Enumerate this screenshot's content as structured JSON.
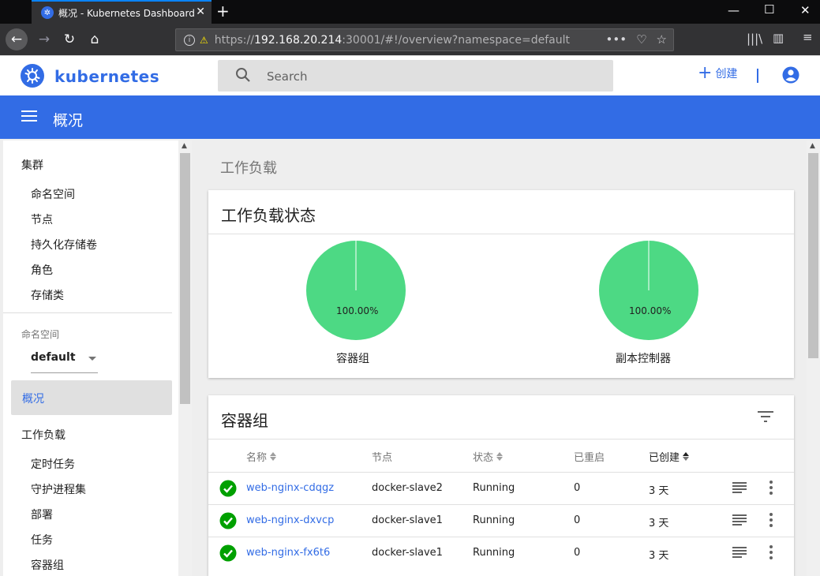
{
  "browser": {
    "tab_title": "概况 - Kubernetes Dashboard",
    "url_proto": "https://",
    "url_host": "192.168.20.214",
    "url_rest": ":30001/#!/overview?namespace=default"
  },
  "header": {
    "brand": "kubernetes",
    "search_placeholder": "Search",
    "create_label": "创建",
    "page_title": "概况"
  },
  "sidebar": {
    "cluster_header": "集群",
    "cluster_items": [
      "命名空间",
      "节点",
      "持久化存储卷",
      "角色",
      "存储类"
    ],
    "namespace_label": "命名空间",
    "namespace_value": "default",
    "overview": "概况",
    "workloads_header": "工作负载",
    "workload_items": [
      "定时任务",
      "守护进程集",
      "部署",
      "任务",
      "容器组"
    ]
  },
  "main": {
    "section_title": "工作负载",
    "status_card_title": "工作负载状态",
    "charts": [
      {
        "label": "容器组",
        "percent": "100.00%",
        "running": 100
      },
      {
        "label": "副本控制器",
        "percent": "100.00%",
        "running": 100
      }
    ],
    "pods_card_title": "容器组",
    "columns": [
      "名称",
      "节点",
      "状态",
      "已重启",
      "已创建"
    ],
    "rows": [
      {
        "name": "web-nginx-cdqgz",
        "node": "docker-slave2",
        "status": "Running",
        "restarts": "0",
        "created": "3 天"
      },
      {
        "name": "web-nginx-dxvcp",
        "node": "docker-slave1",
        "status": "Running",
        "restarts": "0",
        "created": "3 天"
      },
      {
        "name": "web-nginx-fx6t6",
        "node": "docker-slave1",
        "status": "Running",
        "restarts": "0",
        "created": "3 天"
      }
    ]
  },
  "colors": {
    "brand": "#326ce5",
    "running": "#4dd984",
    "success": "#00a000"
  }
}
